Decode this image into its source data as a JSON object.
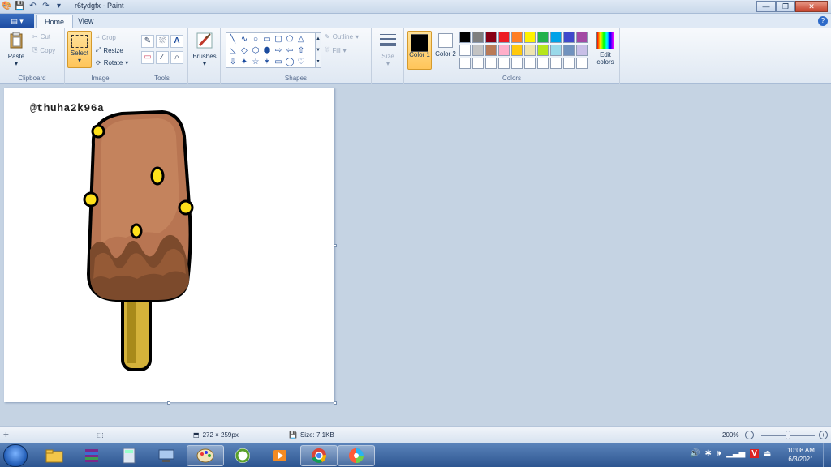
{
  "window": {
    "title": "r6tydgfx - Paint",
    "min": "—",
    "max": "❐",
    "close": "✕"
  },
  "tabs": {
    "file": "▤ ▾",
    "home": "Home",
    "view": "View",
    "help": "?"
  },
  "clipboard": {
    "paste": "Paste",
    "cut": "Cut",
    "copy": "Copy",
    "label": "Clipboard"
  },
  "image": {
    "select": "Select",
    "crop": "Crop",
    "resize": "Resize",
    "rotate": "Rotate",
    "label": "Image"
  },
  "tools": {
    "label": "Tools",
    "items": [
      "✎",
      "⛆",
      "A",
      "▭",
      "⁄",
      "⌕"
    ]
  },
  "brushes": {
    "label": "Brushes"
  },
  "shapes": {
    "label": "Shapes",
    "outline": "Outline",
    "fill": "Fill",
    "items": [
      "╲",
      "∿",
      "○",
      "▭",
      "▢",
      "⬠",
      "△",
      "◺",
      "◇",
      "⬡",
      "⬢",
      "⇨",
      "⇦",
      "⇧",
      "⇩",
      "✦",
      "☆",
      "✶",
      "▭",
      "◯",
      "♡"
    ]
  },
  "size": {
    "label": "Size"
  },
  "colors": {
    "label": "Colors",
    "color1": "Color 1",
    "color1_value": "#000000",
    "color2": "Color 2",
    "color2_value": "#ffffff",
    "edit": "Edit colors",
    "palette_row1": [
      "#000000",
      "#7f7f7f",
      "#880015",
      "#ed1c24",
      "#ff7f27",
      "#fff200",
      "#22b14c",
      "#00a2e8",
      "#3f48cc",
      "#a349a4"
    ],
    "palette_row2": [
      "#ffffff",
      "#c3c3c3",
      "#b97a57",
      "#ffaec9",
      "#ffc90e",
      "#efe4b0",
      "#b5e61d",
      "#99d9ea",
      "#7092be",
      "#c8bfe7"
    ]
  },
  "canvas": {
    "watermark": "@thuha2k96a"
  },
  "status": {
    "dimensions": "272 × 259px",
    "size": "Size: 7.1KB",
    "zoom": "200%"
  },
  "clock": {
    "time": "10:08 AM",
    "date": "6/3/2021"
  }
}
